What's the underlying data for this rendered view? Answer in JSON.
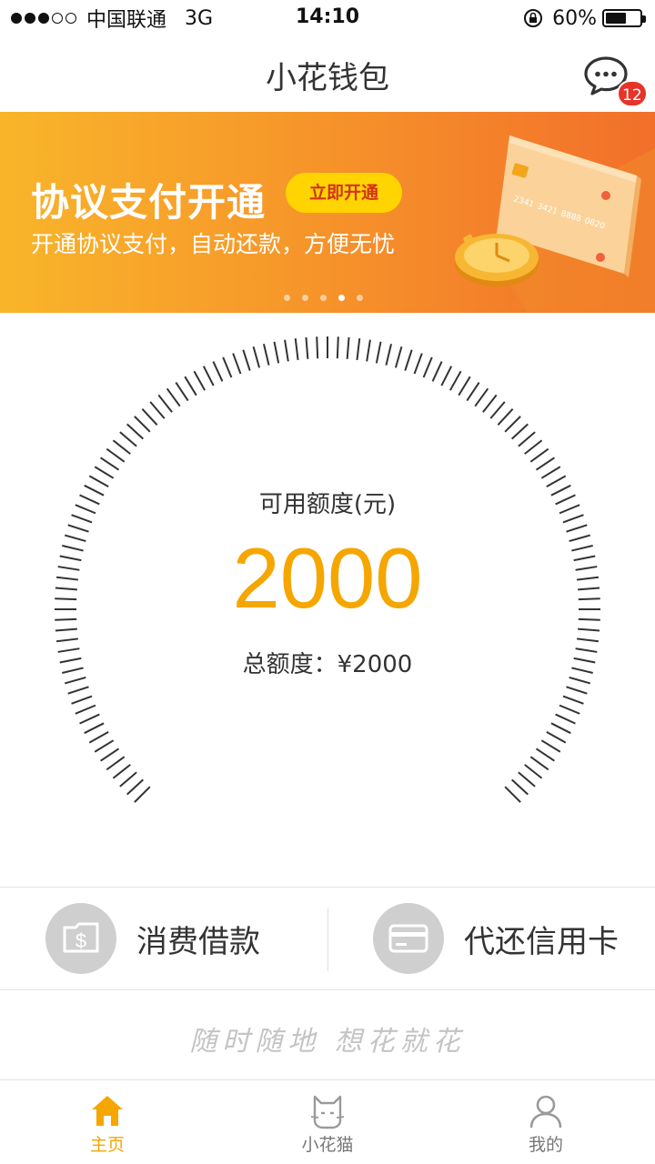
{
  "status_bar": {
    "carrier": "中国联通",
    "network": "3G",
    "time": "14:10",
    "battery_text": "60%",
    "battery_level": 0.6,
    "signal_bars": 3,
    "signal_max": 5
  },
  "nav": {
    "title": "小花钱包",
    "message_icon": "chat-bubble-icon",
    "message_badge": "12"
  },
  "banner": {
    "title": "协议支付开通",
    "button_label": "立即开通",
    "subtitle": "开通协议支付，自动还款，方便无忧",
    "card_numbers": [
      "2341",
      "3421",
      "8888",
      "0820"
    ],
    "page_count": 5,
    "active_page": 4
  },
  "credit": {
    "label": "可用额度(元)",
    "available": "2000",
    "total_label": "总额度：¥2000"
  },
  "actions": [
    {
      "label": "消费借款",
      "icon": "wallet-dollar-icon"
    },
    {
      "label": "代还信用卡",
      "icon": "credit-card-icon"
    }
  ],
  "slogan": "随时随地 想花就花",
  "tabs": [
    {
      "label": "主页",
      "icon": "home-icon",
      "active": true
    },
    {
      "label": "小花猫",
      "icon": "cat-icon",
      "active": false
    },
    {
      "label": "我的",
      "icon": "user-icon",
      "active": false
    }
  ],
  "colors": {
    "accent": "#f5a600",
    "banner_start": "#f9b52a",
    "banner_end": "#f26f2a",
    "badge": "#e5342a",
    "icon_gray": "#cfcfcf"
  }
}
